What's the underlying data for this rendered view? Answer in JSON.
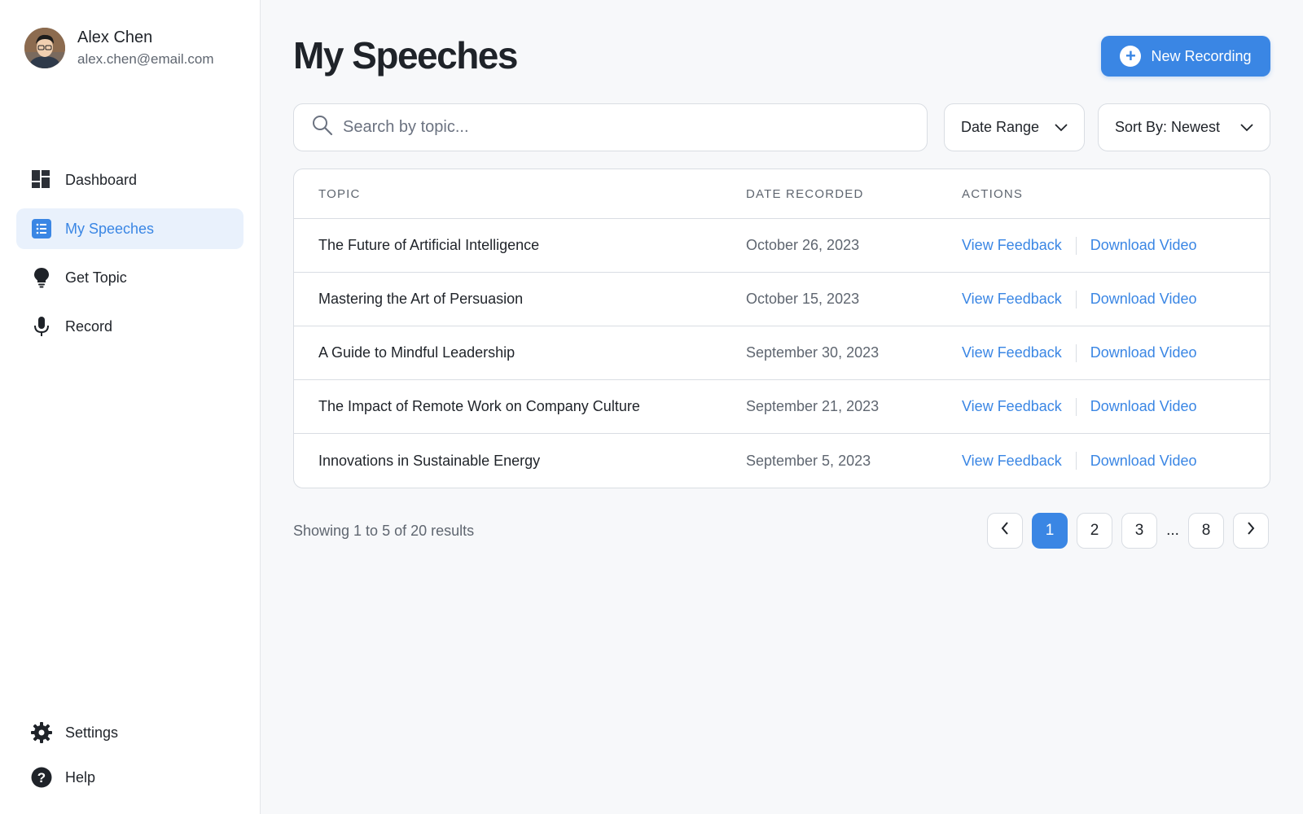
{
  "user": {
    "name": "Alex Chen",
    "email": "alex.chen@email.com"
  },
  "sidebar": {
    "items": [
      {
        "label": "Dashboard",
        "icon": "dashboard-icon"
      },
      {
        "label": "My Speeches",
        "icon": "list-icon",
        "active": true
      },
      {
        "label": "Get Topic",
        "icon": "lightbulb-icon"
      },
      {
        "label": "Record",
        "icon": "microphone-icon"
      }
    ],
    "bottom": [
      {
        "label": "Settings",
        "icon": "gear-icon"
      },
      {
        "label": "Help",
        "icon": "help-icon"
      }
    ]
  },
  "header": {
    "title": "My Speeches",
    "new_button": "New Recording"
  },
  "filters": {
    "search_placeholder": "Search by topic...",
    "date_range": "Date Range",
    "sort": "Sort By: Newest"
  },
  "table": {
    "headers": {
      "topic": "TOPIC",
      "date": "DATE RECORDED",
      "actions": "ACTIONS"
    },
    "action_labels": {
      "feedback": "View Feedback",
      "download": "Download Video"
    },
    "rows": [
      {
        "topic": "The Future of Artificial Intelligence",
        "date": "October 26, 2023"
      },
      {
        "topic": "Mastering the Art of Persuasion",
        "date": "October 15, 2023"
      },
      {
        "topic": "A Guide to Mindful Leadership",
        "date": "September 30, 2023"
      },
      {
        "topic": "The Impact of Remote Work on Company Culture",
        "date": "September 21, 2023"
      },
      {
        "topic": "Innovations in Sustainable Energy",
        "date": "September 5, 2023"
      }
    ]
  },
  "pagination": {
    "summary": "Showing 1 to 5 of 20 results",
    "pages": [
      "1",
      "2",
      "3",
      "8"
    ],
    "current": "1",
    "ellipsis": "..."
  },
  "colors": {
    "accent": "#3a86e4",
    "active_bg": "#e9f1fc",
    "page_bg": "#f7f8fa",
    "border": "#d9dde3"
  }
}
